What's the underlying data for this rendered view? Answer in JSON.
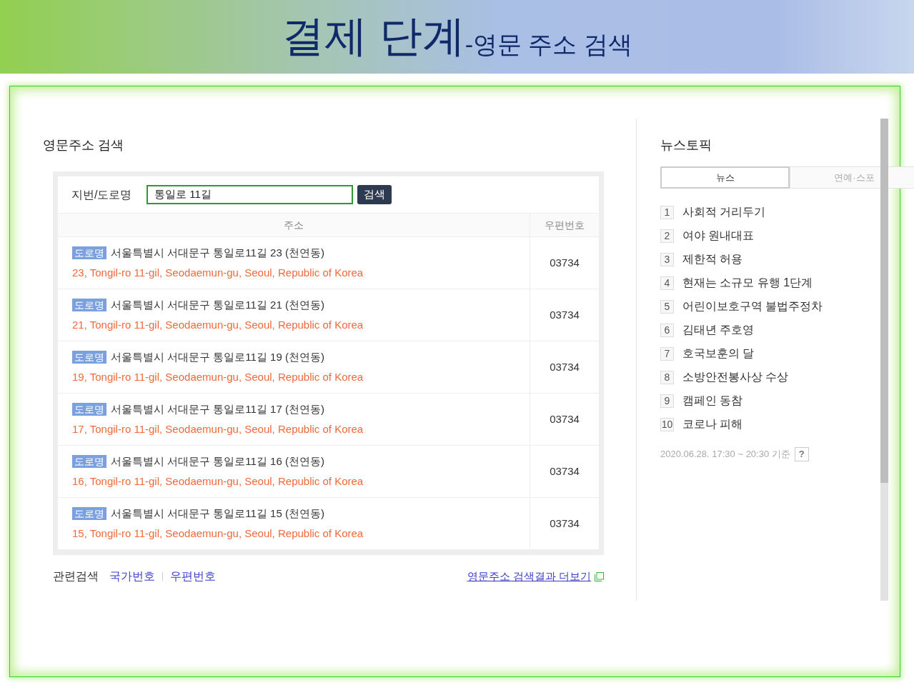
{
  "slide": {
    "title": "결제 단계",
    "subtitle": "-영문 주소 검색"
  },
  "search_panel": {
    "heading": "영문주소 검색",
    "field_label": "지번/도로명",
    "search_value": "통일로 11길",
    "search_button": "검색",
    "columns": [
      "주소",
      "우편번호"
    ],
    "rows": [
      {
        "badge": "도로명",
        "korean_address": "서울특별시 서대문구 통일로11길 23 (천연동)",
        "english_address": "23, Tongil-ro 11-gil, Seodaemun-gu, Seoul, Republic of Korea",
        "postal_code": "03734"
      },
      {
        "badge": "도로명",
        "korean_address": "서울특별시 서대문구 통일로11길 21 (천연동)",
        "english_address": "21, Tongil-ro 11-gil, Seodaemun-gu, Seoul, Republic of Korea",
        "postal_code": "03734"
      },
      {
        "badge": "도로명",
        "korean_address": "서울특별시 서대문구 통일로11길 19 (천연동)",
        "english_address": "19, Tongil-ro 11-gil, Seodaemun-gu, Seoul, Republic of Korea",
        "postal_code": "03734"
      },
      {
        "badge": "도로명",
        "korean_address": "서울특별시 서대문구 통일로11길 17 (천연동)",
        "english_address": "17, Tongil-ro 11-gil, Seodaemun-gu, Seoul, Republic of Korea",
        "postal_code": "03734"
      },
      {
        "badge": "도로명",
        "korean_address": "서울특별시 서대문구 통일로11길 16 (천연동)",
        "english_address": "16, Tongil-ro 11-gil, Seodaemun-gu, Seoul, Republic of Korea",
        "postal_code": "03734"
      },
      {
        "badge": "도로명",
        "korean_address": "서울특별시 서대문구 통일로11길 15 (천연동)",
        "english_address": "15, Tongil-ro 11-gil, Seodaemun-gu, Seoul, Republic of Korea",
        "postal_code": "03734"
      }
    ],
    "related_label": "관련검색",
    "related_links": [
      "국가번호",
      "우편번호"
    ],
    "more_link": "영문주소 검색결과 더보기"
  },
  "news_topics": {
    "heading": "뉴스토픽",
    "tabs": [
      {
        "label": "뉴스",
        "selected": true
      },
      {
        "label": "연예·스포",
        "selected": false
      }
    ],
    "items": [
      {
        "rank": "1",
        "title": "사회적 거리두기"
      },
      {
        "rank": "2",
        "title": "여야 원내대표"
      },
      {
        "rank": "3",
        "title": "제한적 허용"
      },
      {
        "rank": "4",
        "title": "현재는 소규모 유행 1단계"
      },
      {
        "rank": "5",
        "title": "어린이보호구역 불법주정차"
      },
      {
        "rank": "6",
        "title": "김태년 주호영"
      },
      {
        "rank": "7",
        "title": "호국보훈의 달"
      },
      {
        "rank": "8",
        "title": "소방안전봉사상 수상"
      },
      {
        "rank": "9",
        "title": "캠페인 동참"
      },
      {
        "rank": "10",
        "title": "코로나 피해"
      }
    ],
    "timestamp": "2020.06.28. 17:30 ~ 20:30 기준",
    "help_button": "?"
  }
}
